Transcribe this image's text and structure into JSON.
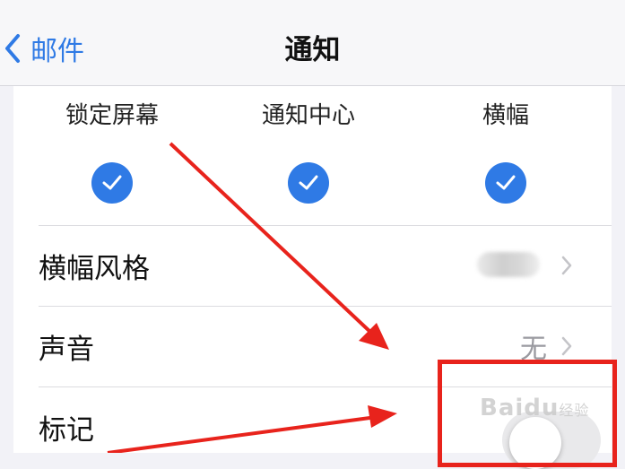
{
  "navbar": {
    "back_label": "邮件",
    "title": "通知"
  },
  "alert_styles": [
    {
      "label": "锁定屏幕",
      "checked": true
    },
    {
      "label": "通知中心",
      "checked": true
    },
    {
      "label": "横幅",
      "checked": true
    }
  ],
  "rows": {
    "banner_style": {
      "title": "横幅风格",
      "value_obscured": true
    },
    "sound": {
      "title": "声音",
      "value": "无"
    },
    "badge": {
      "title": "标记",
      "toggle_on": false
    }
  },
  "watermark": {
    "text": "Baidu",
    "suffix": "经验"
  },
  "colors": {
    "accent": "#2f7ae5",
    "annotation": "#e8231c",
    "background": "#f2f2f7"
  }
}
